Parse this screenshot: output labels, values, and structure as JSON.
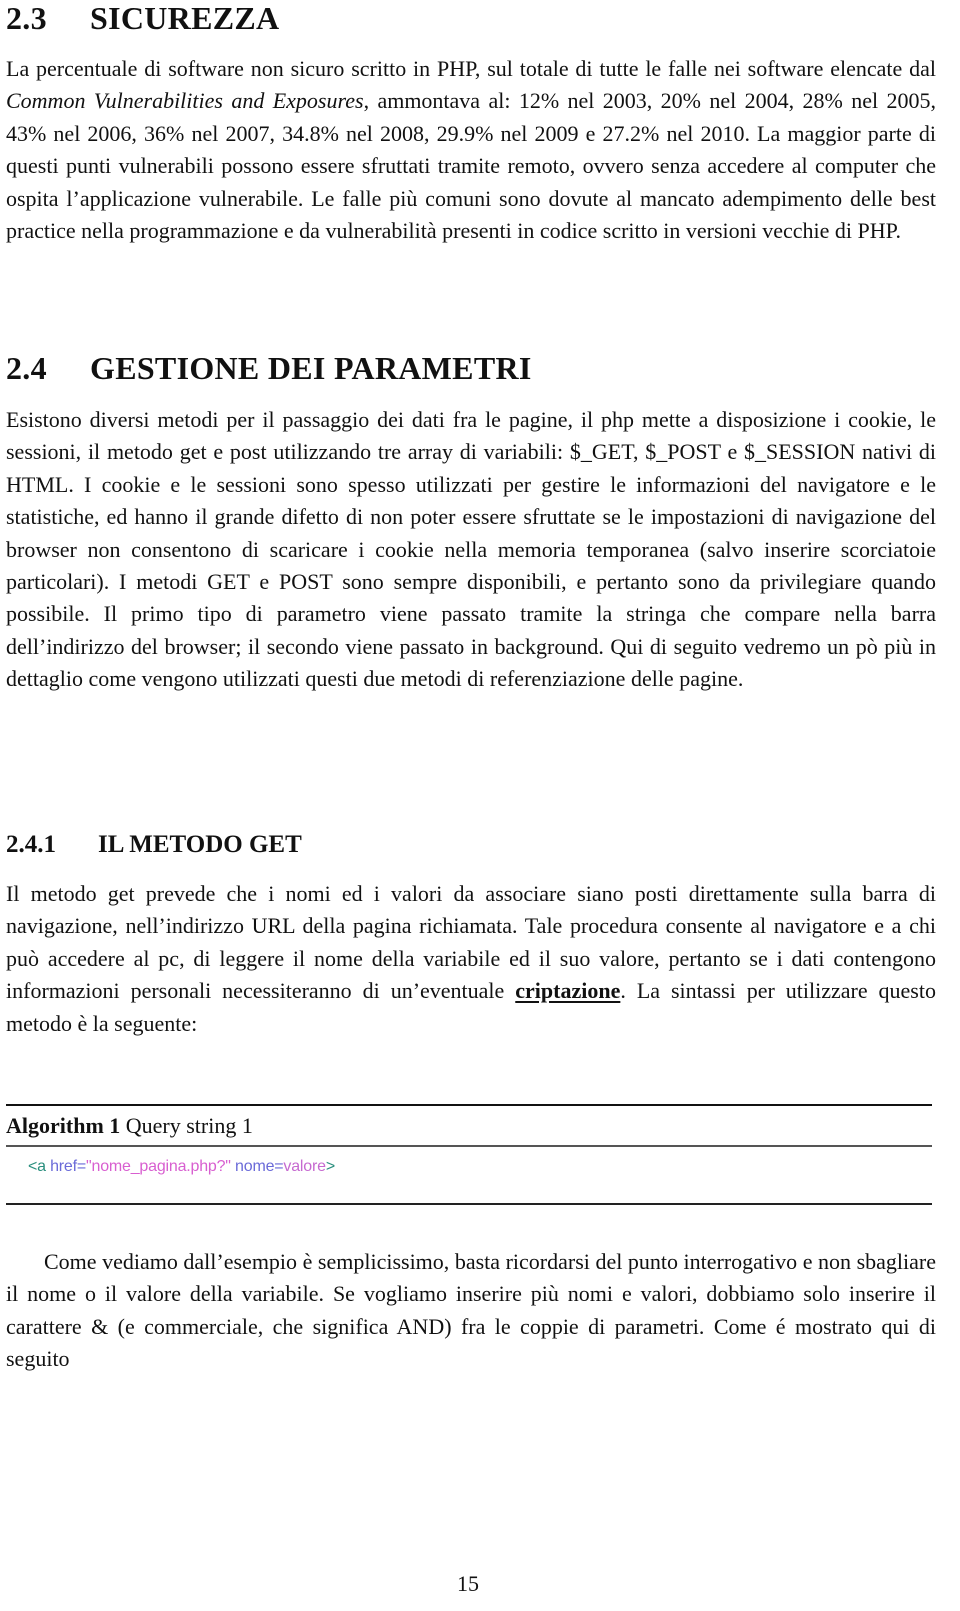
{
  "sections": {
    "s23": {
      "number": "2.3",
      "title": "SICUREZZA",
      "para": {
        "p1": "La percentuale di software non sicuro scritto in PHP, sul totale di tutte le falle nei software elencate dal ",
        "p1_italic": "Common Vulnerabilities and Exposures",
        "p2": ", ammontava al: 12% nel 2003, 20% nel 2004, 28% nel 2005, 43% nel 2006, 36% nel 2007, 34.8% nel 2008, 29.9% nel 2009 e 27.2% nel 2010. La maggior parte di questi punti vulnerabili possono essere sfruttati tramite remoto, ovvero senza accedere al computer che ospita l’applicazione vulnerabile.  Le falle più comuni sono dovute al mancato adempimento delle best practice nella programmazione e da vulnerabilità presenti in codice scritto in versioni vecchie di PHP."
      }
    },
    "s24": {
      "number": "2.4",
      "title": "GESTIONE DEI PARAMETRI",
      "para": "Esistono diversi metodi per il passaggio dei dati fra le pagine, il php mette a disposizione i cookie, le sessioni, il metodo get e post utilizzando tre array di variabili: $_GET, $_POST e $_SESSION nativi di HTML. I cookie e le sessioni sono spesso utilizzati per gestire le informazioni del navigatore e le statistiche, ed hanno il grande difetto di non poter essere sfruttate se le impostazioni di navigazione del browser non consentono di scaricare i cookie nella memoria temporanea (salvo inserire scorciatoie particolari). I metodi GET e POST sono sempre disponibili, e pertanto sono da privilegiare quando possibile.  Il primo tipo di parametro viene passato tramite la stringa che compare nella barra dell’indirizzo del browser; il secondo viene passato in background.  Qui di seguito vedremo un pò più in dettaglio come vengono utilizzati questi due metodi di referenziazione delle pagine."
    },
    "s241": {
      "number": "2.4.1",
      "title": "IL METODO GET",
      "para": {
        "p1": "Il metodo get prevede che i nomi ed i valori da associare siano posti direttamente sulla barra di navigazione, nell’indirizzo URL della pagina richiamata. Tale procedura consente al navigatore e a chi può accedere al pc, di leggere il nome della variabile ed il suo valore, pertanto se i dati contengono informazioni personali necessiteranno di un’eventuale ",
        "link": "criptazione",
        "p2": ". La sintassi per utilizzare questo metodo è la seguente:"
      }
    }
  },
  "algorithm": {
    "label": "Algorithm 1",
    "caption": "Query string 1",
    "code": {
      "tag_open": "<a",
      "attr": " href=",
      "str": "\"nome_pagina.php?\"",
      "name": " nome=",
      "value": "valore",
      "tag_close": ">"
    }
  },
  "after_algorithm": "Come vediamo dall’esempio è semplicissimo, basta ricordarsi del punto interrogativo e non sbagliare il nome o il valore della variabile. Se vogliamo inserire più nomi e valori, dobbiamo solo inserire il carattere & (e commerciale, che significa AND) fra le coppie di parametri.  Come é mostrato qui di seguito",
  "page_number": "15",
  "colors": {
    "code_tag": "#2a8f7e",
    "code_attr": "#6a6ad8",
    "code_string": "#d85fd0"
  }
}
